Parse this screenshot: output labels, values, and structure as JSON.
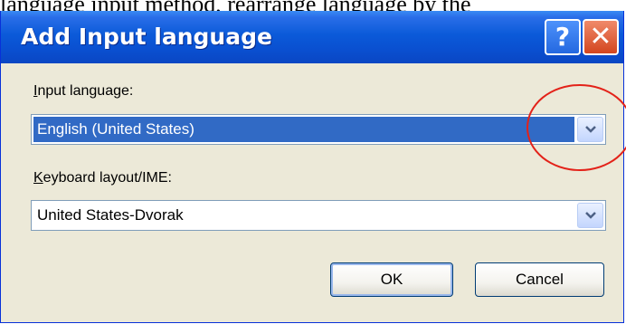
{
  "caption_text": "language input method, rearrange language by the",
  "dialog": {
    "title": "Add Input language",
    "help_glyph": "?",
    "close_glyph": "✕",
    "input_language": {
      "label_mnemonic": "I",
      "label_rest": "nput language:",
      "value": "English (United States)"
    },
    "keyboard_layout": {
      "label_mnemonic": "K",
      "label_rest": "eyboard layout/IME:",
      "value": "United States-Dvorak"
    },
    "ok_label": "OK",
    "cancel_label": "Cancel"
  },
  "colors": {
    "titlebar": "#0a4fd0",
    "selection": "#316ac5",
    "annotation_circle": "#e32219",
    "close_button": "#d3461f"
  }
}
